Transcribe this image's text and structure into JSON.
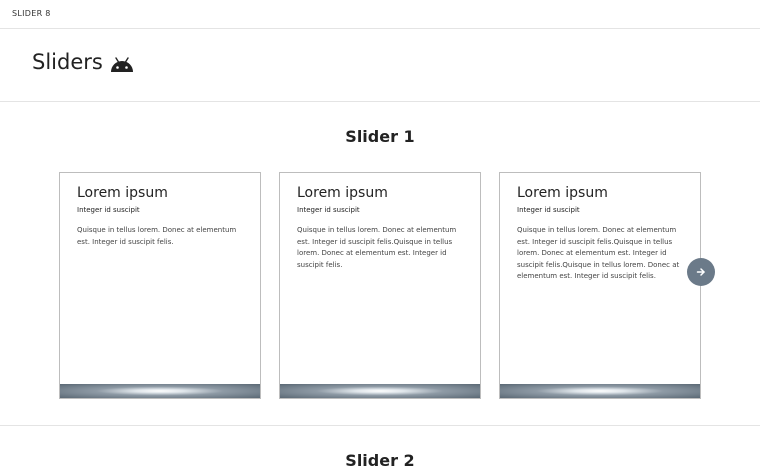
{
  "topbar": {
    "label": "SLIDER 8"
  },
  "header": {
    "title": "Sliders",
    "icon": "android-icon"
  },
  "slider1": {
    "title": "Slider 1",
    "cards": [
      {
        "heading": "Lorem ipsum",
        "subheading": "Integer id suscipit",
        "body": "Quisque in tellus lorem. Donec at elementum est. Integer id suscipit felis."
      },
      {
        "heading": "Lorem ipsum",
        "subheading": "Integer id suscipit",
        "body": "Quisque in tellus lorem. Donec at elementum est. Integer id suscipit felis.Quisque in tellus lorem. Donec at elementum est. Integer id suscipit felis."
      },
      {
        "heading": "Lorem ipsum",
        "subheading": "Integer id suscipit",
        "body": "Quisque in tellus lorem. Donec at elementum est. Integer id suscipit felis.Quisque in tellus lorem. Donec at elementum est. Integer id suscipit felis.Quisque in tellus lorem. Donec at elementum est. Integer id suscipit felis."
      }
    ],
    "next_icon": "arrow-right-icon"
  },
  "slider2": {
    "title": "Slider 2"
  },
  "colors": {
    "accent": "#6b7a89",
    "footer_dark": "#5a6874",
    "border": "#bdbdbd"
  }
}
